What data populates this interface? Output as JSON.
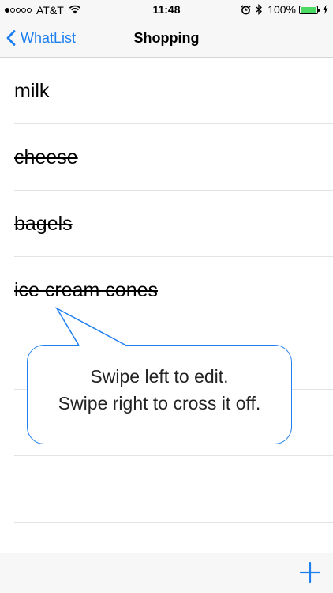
{
  "status_bar": {
    "carrier": "AT&T",
    "time": "11:48",
    "battery_percent": "100%",
    "signal_bars_filled": 1,
    "signal_bars_total": 5
  },
  "nav": {
    "back_label": "WhatList",
    "title": "Shopping"
  },
  "list": {
    "items": [
      {
        "label": "milk",
        "crossed": false
      },
      {
        "label": "cheese",
        "crossed": true
      },
      {
        "label": "bagels",
        "crossed": true
      },
      {
        "label": "ice cream cones",
        "crossed": true
      }
    ]
  },
  "tooltip": {
    "line1": "Swipe left to edit.",
    "line2": "Swipe right to cross it off."
  },
  "colors": {
    "accent": "#1e7ff0",
    "battery": "#4cd964"
  },
  "icons": {
    "back": "chevron-left-icon",
    "add": "plus-icon",
    "wifi": "wifi-icon",
    "alarm": "alarm-icon",
    "bluetooth": "bluetooth-icon",
    "charging": "bolt-icon"
  }
}
